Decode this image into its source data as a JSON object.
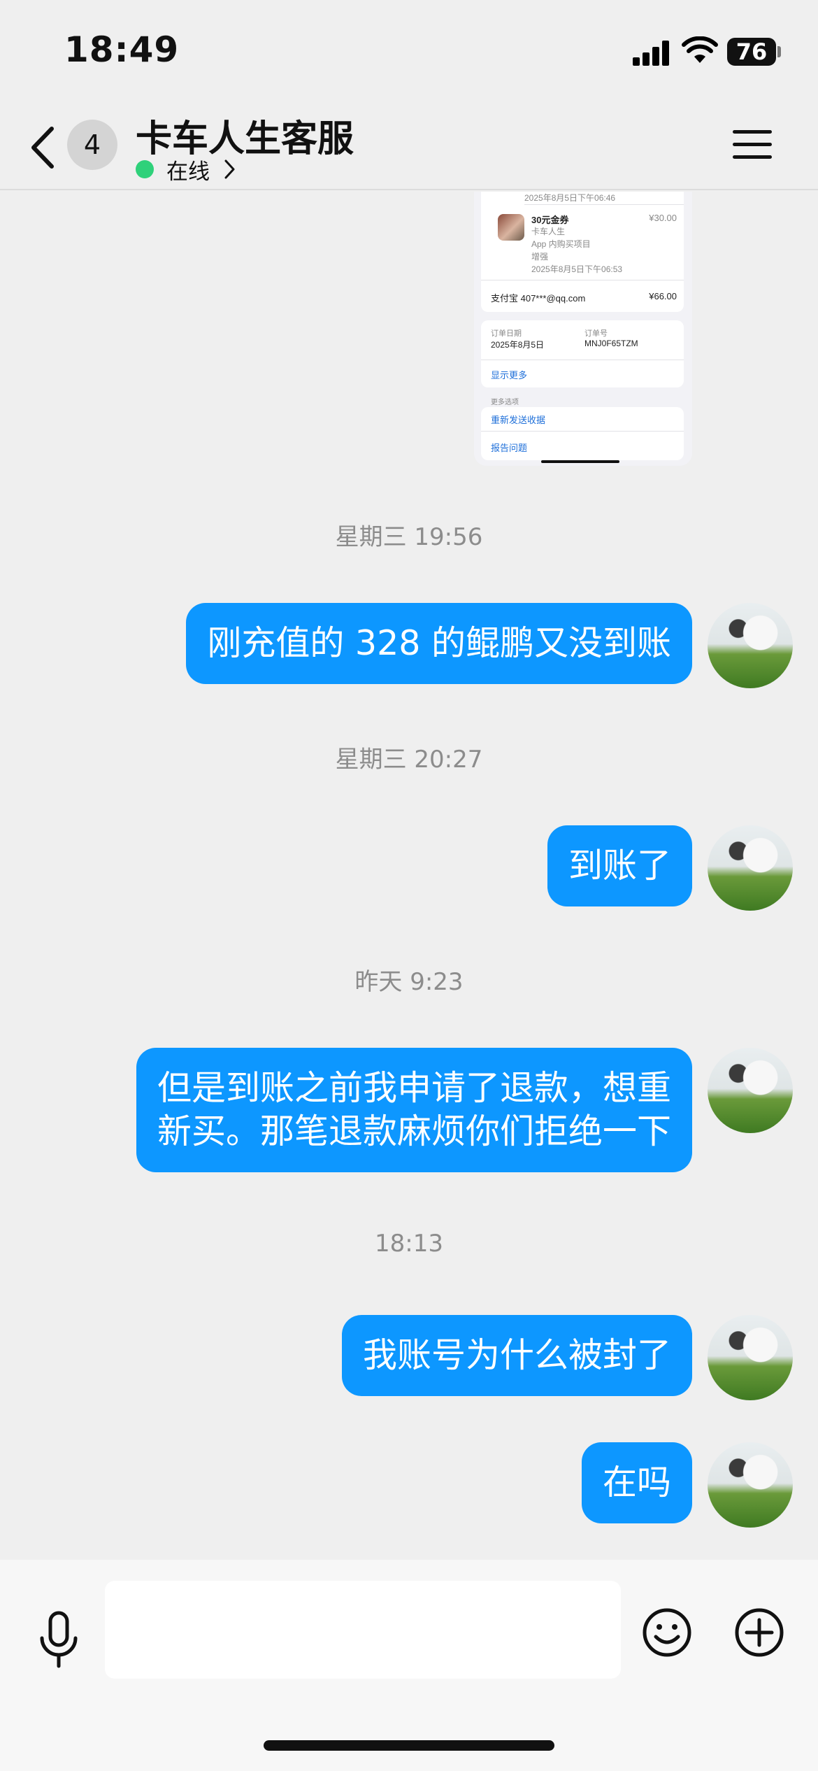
{
  "status_bar": {
    "time": "18:49",
    "battery_level": "76"
  },
  "header": {
    "unread_count": "4",
    "title": "卡车人生客服",
    "status": "在线"
  },
  "receipt": {
    "prev_item_time": "2025年8月5日下午06:46",
    "item_name": "30元金券",
    "item_price": "¥30.00",
    "item_app": "卡车人生",
    "item_type": "App 内购买项目",
    "item_status": "增强",
    "item_time": "2025年8月5日下午06:53",
    "payment_method": "支付宝 407***@qq.com",
    "payment_total": "¥66.00",
    "order_date_label": "订单日期",
    "order_date": "2025年8月5日",
    "order_no_label": "订单号",
    "order_no": "MNJ0F65TZM",
    "show_more": "显示更多",
    "more_options_label": "更多选项",
    "resend_receipt": "重新发送收据",
    "report_problem": "报告问题"
  },
  "messages": [
    {
      "time": "星期三 19:56",
      "text": [
        "刚充值的 328 的鲲鹏又没到账"
      ]
    },
    {
      "time": "星期三 20:27",
      "text": [
        "到账了"
      ]
    },
    {
      "time": "昨天 9:23",
      "text": [
        "但是到账之前我申请了退款，想重",
        "新买。那笔退款麻烦你们拒绝一下"
      ]
    },
    {
      "time": "18:13",
      "text": [
        "我账号为什么被封了"
      ]
    },
    {
      "time": "",
      "text": [
        "在吗"
      ]
    }
  ],
  "input": {
    "placeholder": ""
  },
  "colors": {
    "bubble": "#0d97ff",
    "online_dot": "#2fd17a",
    "background": "#efefef"
  },
  "icons": [
    "back-chevron-icon",
    "menu-icon",
    "microphone-icon",
    "emoji-icon",
    "plus-icon",
    "signal-icon",
    "wifi-icon",
    "battery-icon"
  ]
}
